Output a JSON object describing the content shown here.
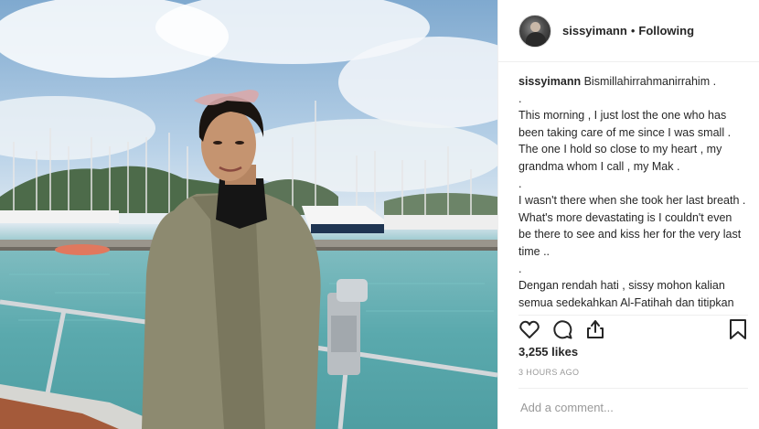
{
  "photo": {
    "alt_icon": "photo-woman-marina"
  },
  "header": {
    "username": "sissyimann",
    "separator": "•",
    "follow_label": "Following"
  },
  "caption": {
    "username": "sissyimann",
    "first": "Bismillahirrahmanirrahim .",
    "lines": [
      ".",
      "This morning , I just lost the one who has been taking care of me since I was small . The one I hold so close to my heart , my grandma whom I call , my Mak .",
      ".",
      "I wasn't there when she took her last breath . What's more devastating is I couldn't even be there to see and kiss her for the very last time ..",
      ".",
      "Dengan rendah hati , sissy mohon kalian semua sedekahkan Al-Fatihah dan titipkan doa buat mak sissy ya .. Juga buat Sissy yang tak tahu la sepanjang mana nak tahan"
    ]
  },
  "actions": {
    "like_icon": "heart-icon",
    "comment_icon": "comment-icon",
    "share_icon": "share-icon",
    "save_icon": "bookmark-icon"
  },
  "likes": "3,255 likes",
  "timestamp": "3 HOURS AGO",
  "comment_box": {
    "placeholder": "Add a comment..."
  }
}
